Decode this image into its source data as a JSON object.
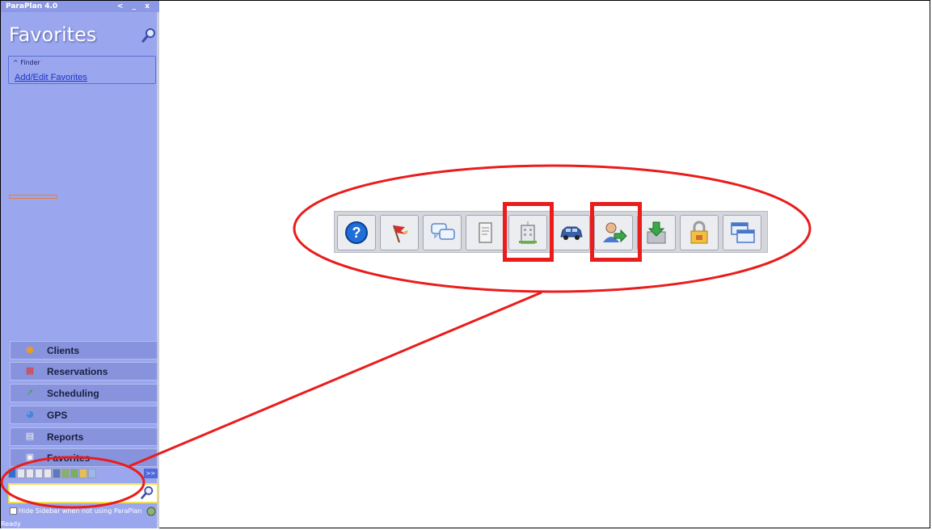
{
  "app": {
    "title": "ParaPlan 4.0",
    "controls": [
      "<",
      "_",
      "x"
    ]
  },
  "sidebar": {
    "page_title": "Favorites",
    "finder": {
      "header": "^ Finder",
      "link": "Add/Edit Favorites"
    },
    "nav": [
      {
        "label": "Clients",
        "icon": "clients-icon"
      },
      {
        "label": "Reservations",
        "icon": "calendar-icon"
      },
      {
        "label": "Scheduling",
        "icon": "scheduling-icon"
      },
      {
        "label": "GPS",
        "icon": "gps-icon"
      },
      {
        "label": "Reports",
        "icon": "reports-icon"
      },
      {
        "label": "Favorites",
        "icon": "favorites-icon"
      }
    ],
    "quickbar_more": ">>",
    "search": {
      "placeholder": ""
    },
    "hide_sidebar_label": "Hide Sidebar when not using ParaPlan",
    "status": "Ready"
  },
  "toolbar": {
    "icons": [
      "help-icon",
      "flag-icon",
      "chat-icon",
      "document-icon",
      "building-icon",
      "car-icon",
      "user-arrow-icon",
      "download-icon",
      "lock-icon",
      "windows-icon"
    ],
    "highlighted": [
      "building-icon",
      "user-arrow-icon"
    ]
  },
  "colors": {
    "sidebar_bg": "#9aa7ee",
    "annotation_red": "#ea1c1c",
    "link": "#1c33c8"
  }
}
